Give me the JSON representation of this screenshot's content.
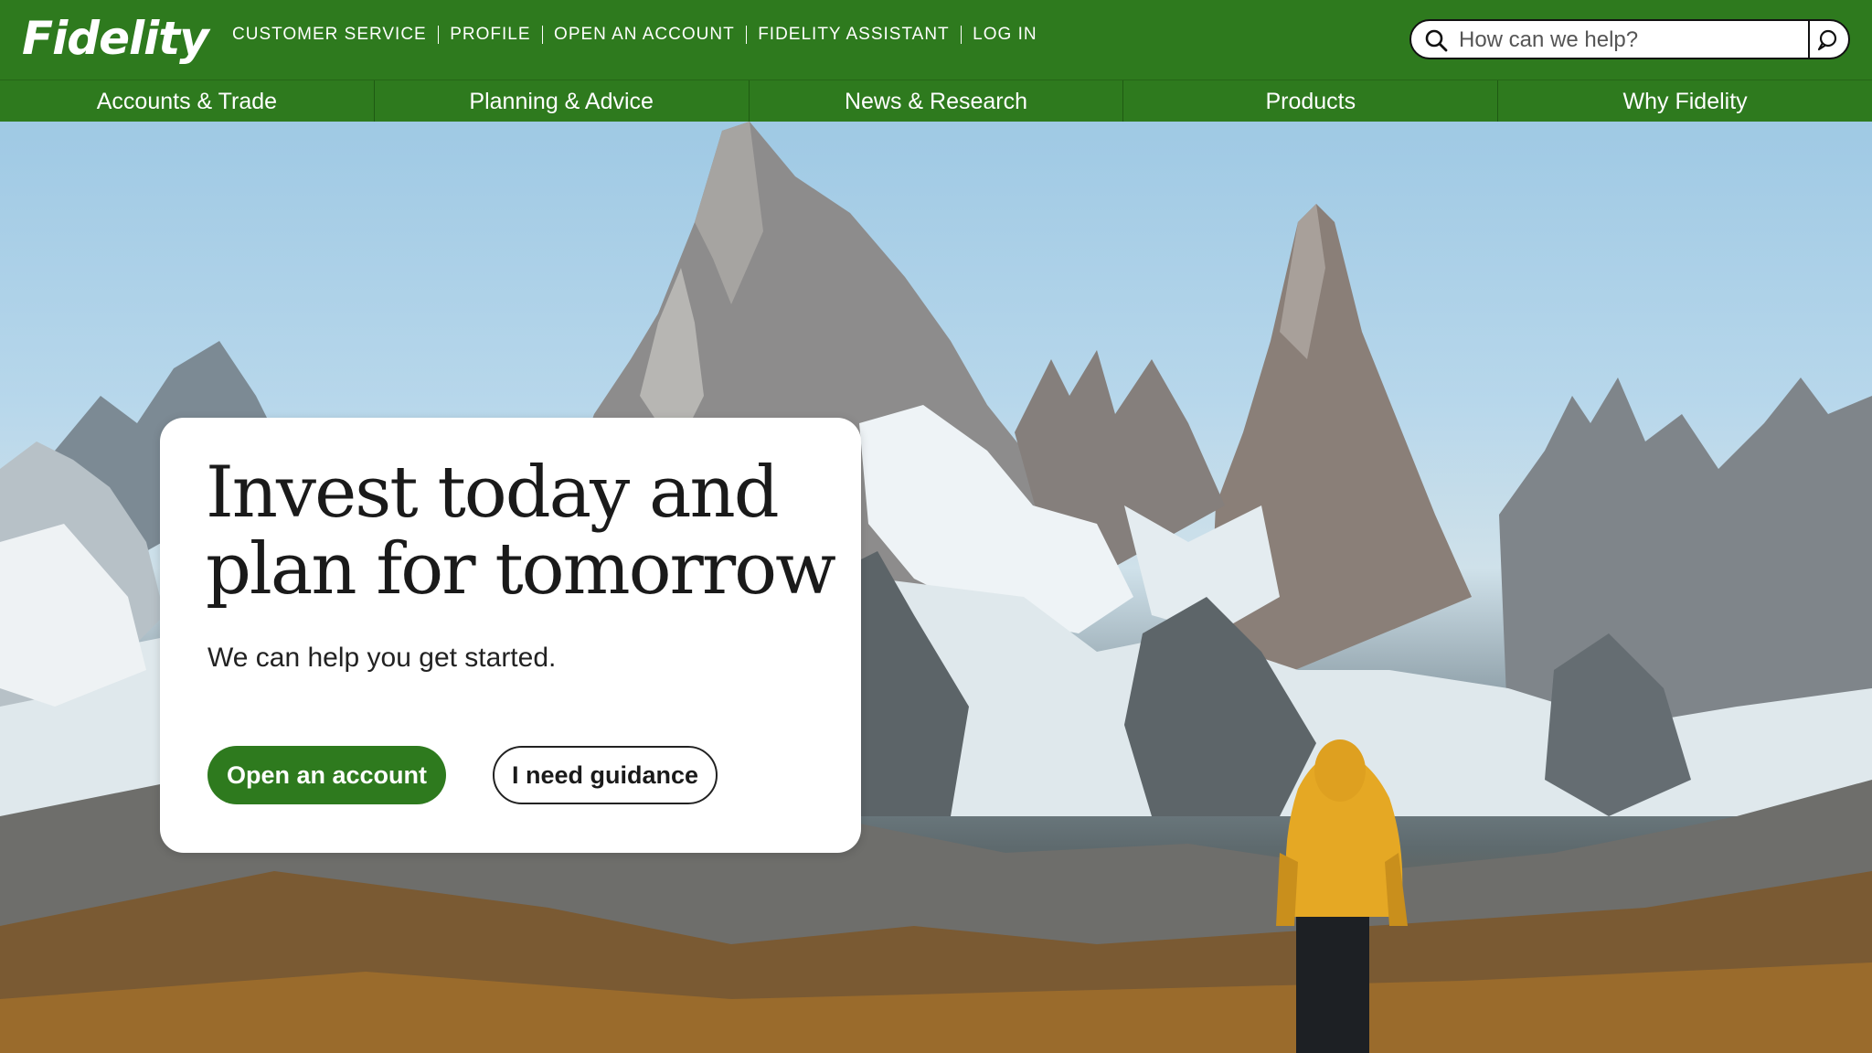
{
  "brand": {
    "logo_text": "Fidelity",
    "primary_color": "#2e7a1e"
  },
  "utility_nav": {
    "items": [
      {
        "label": "CUSTOMER SERVICE"
      },
      {
        "label": "PROFILE"
      },
      {
        "label": "OPEN AN ACCOUNT"
      },
      {
        "label": "FIDELITY ASSISTANT"
      },
      {
        "label": "LOG IN"
      }
    ]
  },
  "search": {
    "placeholder": "How can we help?",
    "value": "",
    "icon": "search-icon",
    "assistant_icon": "chat-bubble-icon"
  },
  "main_nav": {
    "items": [
      {
        "label": "Accounts & Trade"
      },
      {
        "label": "Planning & Advice"
      },
      {
        "label": "News & Research"
      },
      {
        "label": "Products"
      },
      {
        "label": "Why Fidelity"
      }
    ]
  },
  "hero": {
    "title": "Invest today and plan for tomorrow",
    "subtitle": "We can help you get started.",
    "primary_button": "Open an account",
    "secondary_button": "I need guidance"
  }
}
